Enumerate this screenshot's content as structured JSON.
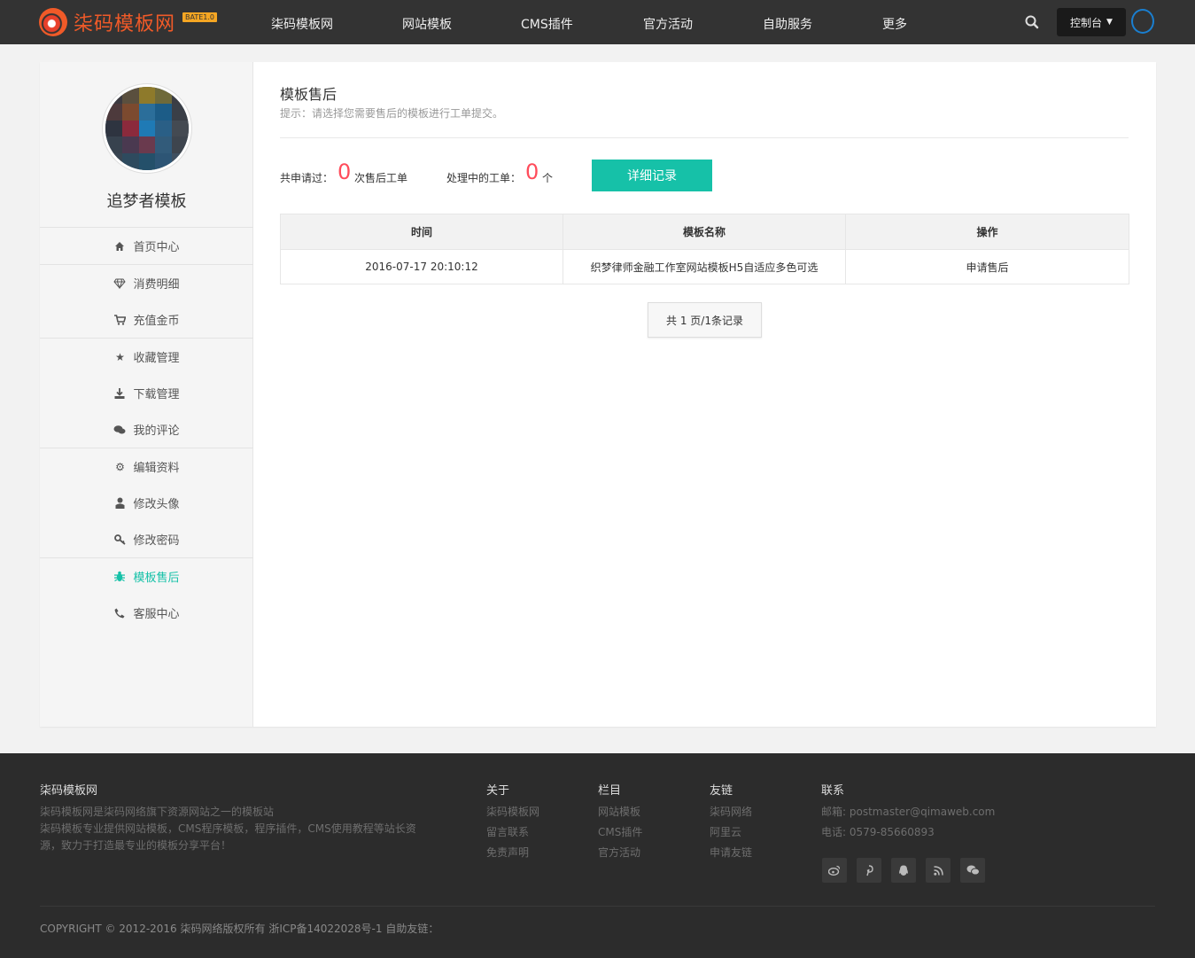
{
  "header": {
    "logo_text": "柒码模板网",
    "logo_badge": "BATE1.0",
    "nav": [
      {
        "label": "柒码模板网"
      },
      {
        "label": "网站模板"
      },
      {
        "label": "CMS插件"
      },
      {
        "label": "官方活动"
      },
      {
        "label": "自助服务"
      },
      {
        "label": "更多"
      }
    ],
    "console_label": "控制台"
  },
  "sidebar": {
    "username": "追梦者模板",
    "items": [
      {
        "label": "首页中心",
        "icon": "home-icon"
      },
      {
        "label": "消费明细",
        "icon": "diamond-icon"
      },
      {
        "label": "充值金币",
        "icon": "cart-icon"
      },
      {
        "label": "收藏管理",
        "icon": "star-icon"
      },
      {
        "label": "下载管理",
        "icon": "download-icon"
      },
      {
        "label": "我的评论",
        "icon": "comments-icon"
      },
      {
        "label": "编辑资料",
        "icon": "gear-icon"
      },
      {
        "label": "修改头像",
        "icon": "user-icon"
      },
      {
        "label": "修改密码",
        "icon": "key-icon"
      },
      {
        "label": "模板售后",
        "icon": "bug-icon"
      },
      {
        "label": "客服中心",
        "icon": "phone-icon"
      }
    ]
  },
  "content": {
    "title": "模板售后",
    "hint": "提示：请选择您需要售后的模板进行工单提交。",
    "stats": {
      "total_prefix": "共申请过：",
      "total_count": "0",
      "total_suffix": "次售后工单",
      "processing_prefix": "处理中的工单：",
      "processing_count": "0",
      "processing_suffix": "个"
    },
    "detail_button": "详细记录",
    "table": {
      "headers": [
        "时间",
        "模板名称",
        "操作"
      ],
      "rows": [
        [
          "2016-07-17 20:10:12",
          "织梦律师金融工作室网站模板H5自适应多色可选",
          "申请售后"
        ]
      ]
    },
    "pager": "共 1 页/1条记录"
  },
  "footer": {
    "brand_title": "柒码模板网",
    "brand_lines": [
      "柒码模板网是柒码网络旗下资源网站之一的模板站",
      "柒码模板专业提供网站模板，CMS程序模板，程序插件，CMS使用教程等站长资源，致力于打造最专业的模板分享平台！"
    ],
    "columns": [
      {
        "title": "关于",
        "links": [
          "柒码模板网",
          "留言联系",
          "免责声明"
        ]
      },
      {
        "title": "栏目",
        "links": [
          "网站模板",
          "CMS插件",
          "官方活动"
        ]
      },
      {
        "title": "友链",
        "links": [
          "柒码网络",
          "阿里云",
          "申请友链"
        ]
      }
    ],
    "contact_title": "联系",
    "email": "邮箱: postmaster@qimaweb.com",
    "phone": "电话: 0579-85660893",
    "social": [
      "weibo-icon",
      "pinterest-icon",
      "qq-icon",
      "rss-icon",
      "wechat-icon"
    ],
    "copyright": "COPYRIGHT © 2012-2016 柒码网络版权所有 浙ICP备14022028号-1 自助友链："
  },
  "colors": {
    "accent": "#16c1a8",
    "brand": "#f05a28",
    "count": "#ff4c5b",
    "header_bg": "#333333",
    "footer_bg": "#2c2c2c"
  }
}
